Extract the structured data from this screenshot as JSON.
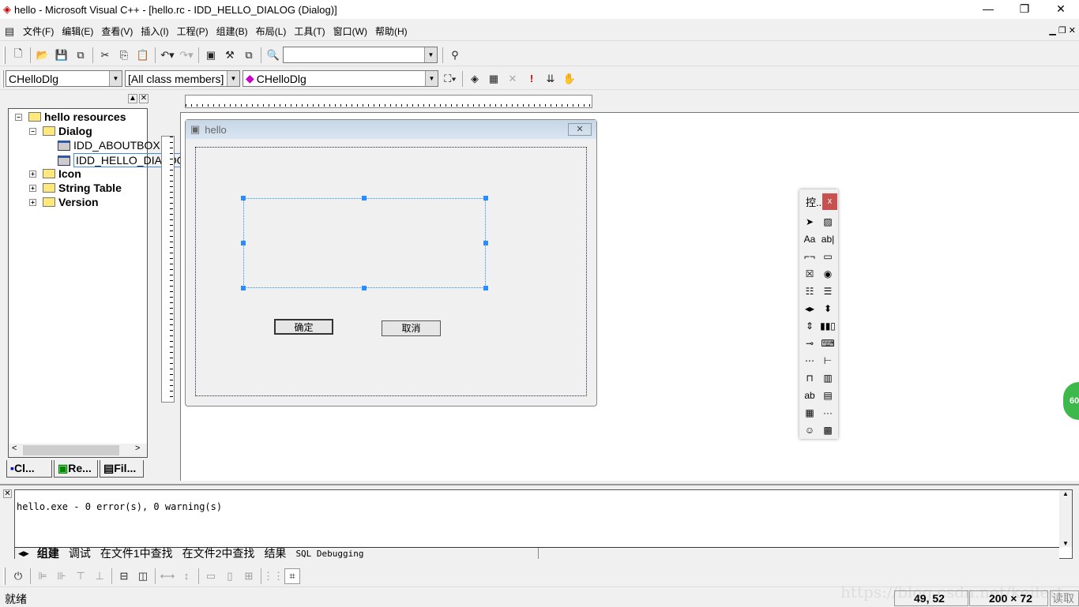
{
  "window": {
    "title": "hello - Microsoft Visual C++ - [hello.rc - IDD_HELLO_DIALOG (Dialog)]",
    "minimize": "—",
    "maximize": "❐",
    "close": "✕"
  },
  "menu": [
    "文件(F)",
    "编辑(E)",
    "查看(V)",
    "插入(I)",
    "工程(P)",
    "组建(B)",
    "布局(L)",
    "工具(T)",
    "窗口(W)",
    "帮助(H)"
  ],
  "toolbar": {
    "find_value": ""
  },
  "wizardbar": {
    "class": "CHelloDlg",
    "filter": "[All class members]",
    "member": "CHelloDlg"
  },
  "workspace": {
    "tree": [
      {
        "label": "hello resources",
        "sign": "−"
      },
      {
        "label": "Dialog",
        "sign": "−"
      },
      {
        "label": "IDD_ABOUTBOX"
      },
      {
        "label": "IDD_HELLO_DIALOG",
        "selected": true
      },
      {
        "label": "Icon",
        "sign": "+"
      },
      {
        "label": "String Table",
        "sign": "+"
      },
      {
        "label": "Version",
        "sign": "+"
      }
    ],
    "tabs": [
      "Cl...",
      "Re...",
      "Fil..."
    ]
  },
  "dialog": {
    "title": "hello",
    "ok": "确定",
    "cancel": "取消"
  },
  "palette": {
    "title": "控...",
    "close": "x",
    "icons": [
      "pointer",
      "picture",
      "static-text",
      "edit-box",
      "group-box",
      "button",
      "check-box",
      "radio-button",
      "combo-box",
      "list-box",
      "horizontal-scrollbar",
      "vertical-scrollbar",
      "spin",
      "progress",
      "slider",
      "hotkey",
      "list-control",
      "tree-control",
      "tab-control",
      "animate",
      "rich-edit",
      "date-time-picker",
      "month-calendar",
      "ip-address",
      "custom-control",
      "extended-combo"
    ]
  },
  "output": {
    "text": "hello.exe - 0 error(s), 0 warning(s)",
    "tabs": [
      "组建",
      "调试",
      "在文件1中查找",
      "在文件2中查找",
      "结果",
      "SQL Debugging"
    ]
  },
  "status": {
    "text": "就绪",
    "position": "49, 52",
    "size": "200 × 72",
    "mode": "读取",
    "watermark": "https://blog.csdn.net/keilert"
  },
  "badge": "60"
}
